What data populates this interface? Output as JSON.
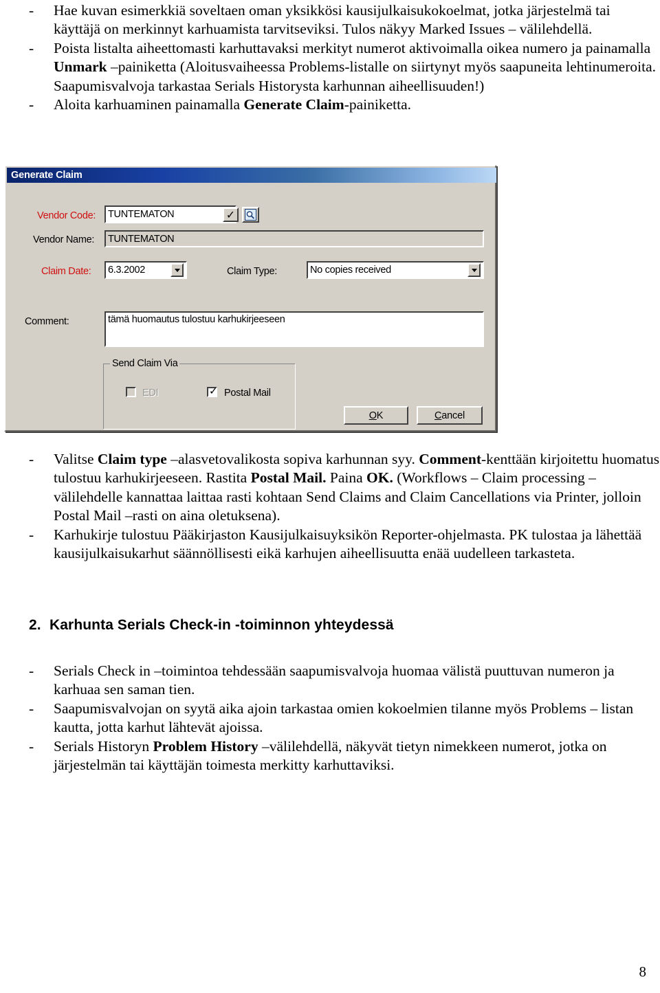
{
  "document": {
    "page_number": "8",
    "top_bullets": [
      {
        "marker": "-",
        "segments": [
          {
            "text": "Hae kuvan esimerkkiä soveltaen oman yksikkösi kausijulkaisukokoelmat, jotka järjestelmä tai käyttäjä on merkinnyt karhuamista tarvitseviksi. Tulos näkyy Marked Issues – välilehdellä.",
            "bold": false
          }
        ]
      },
      {
        "marker": "-",
        "segments": [
          {
            "text": "Poista listalta aiheettomasti karhuttavaksi merkityt numerot aktivoimalla oikea numero ja painamalla ",
            "bold": false
          },
          {
            "text": "Unmark",
            "bold": true
          },
          {
            "text": " –painiketta (Aloitusvaiheessa Problems-listalle on siirtynyt myös saapuneita lehtinumeroita. Saapumisvalvoja tarkastaa Serials Historysta karhunnan aiheellisuuden!)",
            "bold": false
          }
        ]
      },
      {
        "marker": "-",
        "segments": [
          {
            "text": "Aloita karhuaminen painamalla ",
            "bold": false
          },
          {
            "text": "Generate Claim",
            "bold": true
          },
          {
            "text": "-painiketta.",
            "bold": false
          }
        ]
      }
    ],
    "middle_bullets": [
      {
        "marker": "-",
        "segments": [
          {
            "text": "Valitse ",
            "bold": false
          },
          {
            "text": "Claim type",
            "bold": true
          },
          {
            "text": " –alasvetovalikosta sopiva karhunnan syy. ",
            "bold": false
          },
          {
            "text": "Comment",
            "bold": true
          },
          {
            "text": "-kenttään kirjoitettu huomatus tulostuu karhukirjeeseen. Rastita ",
            "bold": false
          },
          {
            "text": "Postal Mail.",
            "bold": true
          },
          {
            "text": " Paina ",
            "bold": false
          },
          {
            "text": "OK.",
            "bold": true
          },
          {
            "text": " (Workflows – Claim processing –välilehdelle kannattaa laittaa rasti kohtaan Send Claims and Claim Cancellations via Printer, jolloin Postal Mail –rasti on aina oletuksena).",
            "bold": false
          }
        ]
      },
      {
        "marker": "-",
        "segments": [
          {
            "text": "Karhukirje tulostuu Pääkirjaston Kausijulkaisuyksikön Reporter-ohjelmasta. PK tulostaa ja lähettää kausijulkaisukarhut säännöllisesti eikä karhujen aiheellisuutta enää uudelleen tarkasteta.",
            "bold": false
          }
        ]
      }
    ],
    "section_heading": {
      "number": "2.",
      "title": "Karhunta Serials Check-in -toiminnon yhteydessä"
    },
    "bottom_bullets": [
      {
        "marker": "-",
        "segments": [
          {
            "text": "Serials Check in –toimintoa tehdessään saapumisvalvoja huomaa välistä puuttuvan numeron ja  karhuaa sen saman tien.",
            "bold": false
          }
        ]
      },
      {
        "marker": "-",
        "segments": [
          {
            "text": "Saapumisvalvojan on syytä aika ajoin tarkastaa omien kokoelmien tilanne myös Problems – listan kautta, jotta karhut lähtevät ajoissa.",
            "bold": false
          }
        ]
      },
      {
        "marker": "-",
        "segments": [
          {
            "text": "Serials Historyn ",
            "bold": false
          },
          {
            "text": "Problem History",
            "bold": true
          },
          {
            "text": " –välilehdellä, näkyvät tietyn nimekkeen numerot, jotka on järjestelmän tai käyttäjän toimesta merkitty karhuttaviksi.",
            "bold": false
          }
        ]
      }
    ]
  },
  "dialog": {
    "title": "Generate Claim",
    "vendor_code": {
      "label": "Vendor Code:",
      "value": "TUNTEMATON",
      "validate_icon": "check-icon",
      "browse_icon": "magnifier-icon"
    },
    "vendor_name": {
      "label": "Vendor Name:",
      "value": "TUNTEMATON"
    },
    "claim_date": {
      "label": "Claim Date:",
      "value": "6.3.2002"
    },
    "claim_type": {
      "label": "Claim Type:",
      "value": "No copies received"
    },
    "comment": {
      "label": "Comment:",
      "value": "tämä huomautus tulostuu karhukirjeeseen"
    },
    "send_claim_via": {
      "group_label": "Send Claim Via",
      "edi": {
        "label": "EDI",
        "checked": false,
        "enabled": false
      },
      "postal_mail": {
        "label": "Postal Mail",
        "checked": true,
        "enabled": true
      }
    },
    "buttons": {
      "ok": "OK",
      "ok_accel": "O",
      "cancel": "Cancel",
      "cancel_accel": "C"
    },
    "colors": {
      "face": "#d4d0c8",
      "title_start": "#0a246a",
      "title_end": "#bcd8f5",
      "required_label": "#d01010"
    }
  }
}
